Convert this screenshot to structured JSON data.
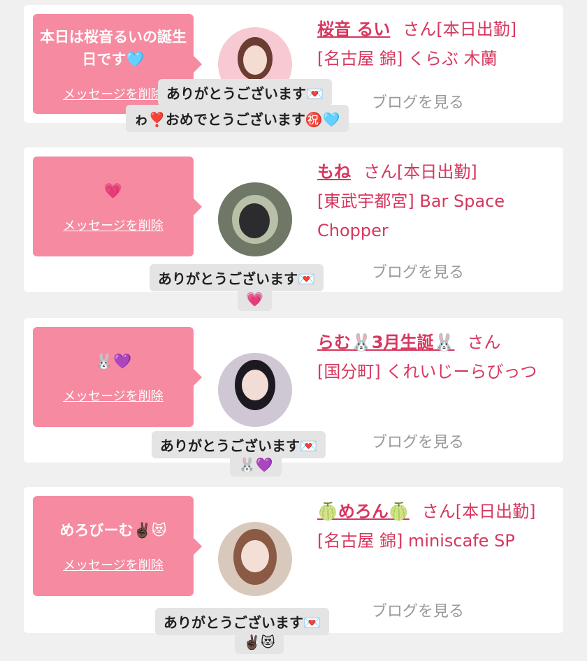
{
  "delete_label": "メッセージを削除",
  "blog_label": "ブログを見る",
  "san_label": "さん",
  "cards": [
    {
      "message": "本日は桜音るいの誕生日です🩵",
      "name": "桜音 るい",
      "status": "[本日出勤]",
      "area": "[名古屋 錦]",
      "shop": "くらぶ 木蘭",
      "reply_line1": "ありがとうございます💌",
      "reply_line2": "ゎ❣️おめでとうございます㊗️🩵"
    },
    {
      "message": "💗",
      "name": "もね",
      "status": "[本日出勤]",
      "area": "[東武宇都宮]",
      "shop": "Bar Space Chopper",
      "reply_line1": "ありがとうございます💌",
      "reply_line2": "💗"
    },
    {
      "message": "🐰💜",
      "name": "らむ🐰3月生誕🐰",
      "status": "",
      "area": "[国分町]",
      "shop": "くれいじーらびっつ",
      "reply_line1": "ありがとうございます💌",
      "reply_line2": "🐰💜"
    },
    {
      "message": "めろびーむ✌🏿😻",
      "name": "🍈めろん🍈",
      "status": "[本日出勤]",
      "area": "[名古屋 錦]",
      "shop": "miniscafe SP",
      "reply_line1": "ありがとうございます💌",
      "reply_line2": "✌🏿😻"
    }
  ],
  "colors": {
    "bubble": "#f58aa0",
    "accent": "#d6375e",
    "background": "#f0f0f0"
  }
}
